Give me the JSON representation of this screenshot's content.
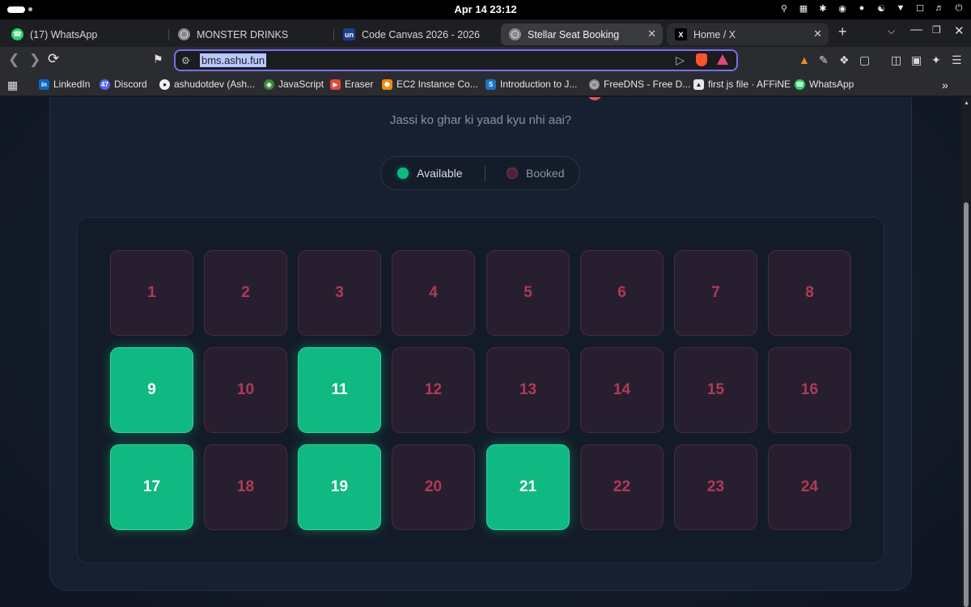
{
  "system_bar": {
    "clock": "Apr 14  23:12"
  },
  "tabs": [
    {
      "label": "(17) WhatsApp",
      "icon": "whatsapp-icon",
      "state": "normal"
    },
    {
      "label": "MONSTER DRINKS",
      "icon": "globe-icon",
      "state": "normal"
    },
    {
      "label": "Code Canvas 2026 - 2026",
      "icon": "unstop-icon",
      "state": "normal"
    },
    {
      "label": "Stellar Seat Booking",
      "icon": "globe-icon",
      "state": "active"
    },
    {
      "label": "Home / X",
      "icon": "x-logo-icon",
      "state": "hover"
    }
  ],
  "address_bar": {
    "url": "bms.ashu.fun"
  },
  "bookmarks": [
    {
      "label": "LinkedIn",
      "icon": "linkedin-icon"
    },
    {
      "label": "Discord",
      "icon": "discord-icon"
    },
    {
      "label": "ashudotdev (Ash...",
      "icon": "github-icon"
    },
    {
      "label": "JavaScript",
      "icon": "javascript-icon"
    },
    {
      "label": "Eraser",
      "icon": "eraser-icon"
    },
    {
      "label": "EC2 Instance Co...",
      "icon": "aws-icon"
    },
    {
      "label": "Introduction to J...",
      "icon": "tutorial-icon"
    },
    {
      "label": "FreeDNS - Free D...",
      "icon": "globe-icon"
    },
    {
      "label": "first js file · AFFiNE",
      "icon": "affine-icon"
    },
    {
      "label": "WhatsApp",
      "icon": "whatsapp-icon"
    }
  ],
  "page": {
    "subtitle": "Jassi ko ghar ki yaad kyu nhi aai?",
    "legend": {
      "available": "Available",
      "booked": "Booked"
    },
    "colors": {
      "available": "#10b981",
      "booked": "#b23a55",
      "card": "#172030"
    },
    "seats": [
      {
        "number": "1",
        "status": "booked"
      },
      {
        "number": "2",
        "status": "booked"
      },
      {
        "number": "3",
        "status": "booked"
      },
      {
        "number": "4",
        "status": "booked"
      },
      {
        "number": "5",
        "status": "booked"
      },
      {
        "number": "6",
        "status": "booked"
      },
      {
        "number": "7",
        "status": "booked"
      },
      {
        "number": "8",
        "status": "booked"
      },
      {
        "number": "9",
        "status": "available"
      },
      {
        "number": "10",
        "status": "booked"
      },
      {
        "number": "11",
        "status": "available"
      },
      {
        "number": "12",
        "status": "booked"
      },
      {
        "number": "13",
        "status": "booked"
      },
      {
        "number": "14",
        "status": "booked"
      },
      {
        "number": "15",
        "status": "booked"
      },
      {
        "number": "16",
        "status": "booked"
      },
      {
        "number": "17",
        "status": "available"
      },
      {
        "number": "18",
        "status": "booked"
      },
      {
        "number": "19",
        "status": "available"
      },
      {
        "number": "20",
        "status": "booked"
      },
      {
        "number": "21",
        "status": "available"
      },
      {
        "number": "22",
        "status": "booked"
      },
      {
        "number": "23",
        "status": "booked"
      },
      {
        "number": "24",
        "status": "booked"
      }
    ]
  }
}
